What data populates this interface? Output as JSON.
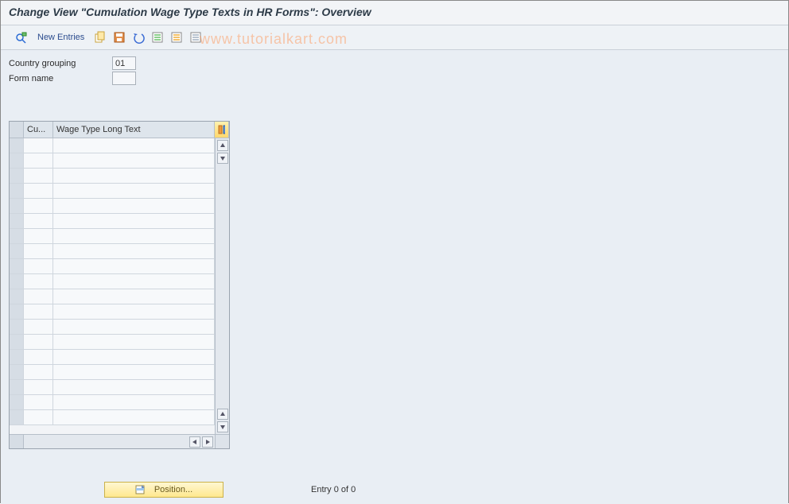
{
  "title": "Change View \"Cumulation Wage Type Texts in HR Forms\": Overview",
  "toolbar": {
    "new_entries": "New Entries"
  },
  "form": {
    "country_grouping_label": "Country grouping",
    "country_grouping_value": "01",
    "form_name_label": "Form name",
    "form_name_value": ""
  },
  "grid": {
    "col1_header": "Cu...",
    "col2_header": "Wage Type Long Text",
    "row_count": 19
  },
  "footer": {
    "position_label": "Position...",
    "entry_text": "Entry 0 of 0"
  },
  "watermark": "www.tutorialkart.com"
}
